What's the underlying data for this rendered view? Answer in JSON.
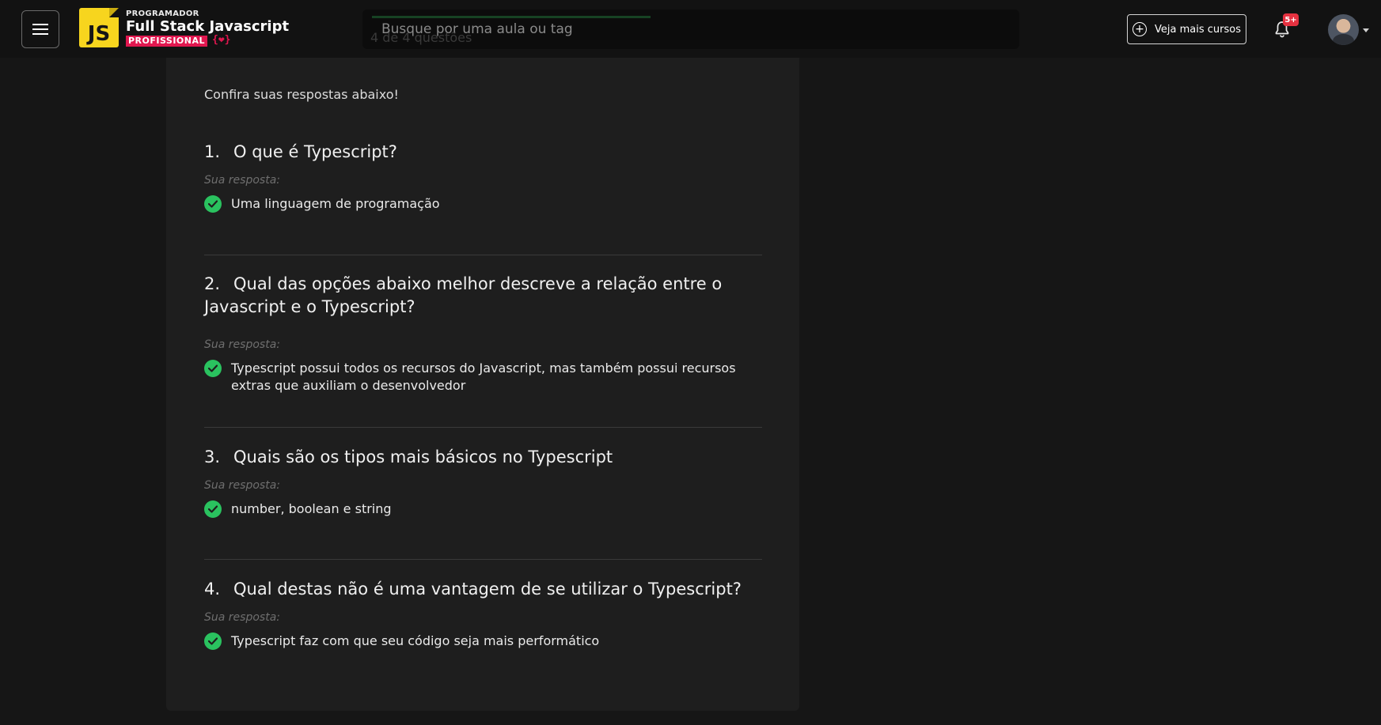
{
  "header": {
    "logo_badge": "JS",
    "logo_line1": "PROGRAMADOR",
    "logo_line2": "Full Stack Javascript",
    "logo_line3": "PROFISSIONAL",
    "logo_line3_suffix": "{❤}",
    "search_placeholder": "Busque por uma aula ou tag",
    "background_text": "4 de 4 questões",
    "more_courses_label": "Veja mais cursos",
    "notification_count": "5+",
    "icons": [
      "menu-icon",
      "plus-circle-icon",
      "bell-icon",
      "chevron-down-icon"
    ]
  },
  "colors": {
    "brand_yellow": "#f7d51e",
    "brand_pink": "#e0174f",
    "check_green": "#2ac25f",
    "badge_red": "#e53140"
  },
  "content": {
    "intro": "Confira suas respostas abaixo!",
    "answer_label": "Sua resposta:",
    "questions": [
      {
        "number": "1.",
        "title": "O que é Typescript?",
        "answer": "Uma linguagem de programação",
        "correct": true
      },
      {
        "number": "2.",
        "title": "Qual das opções abaixo melhor descreve a relação entre o Javascript e o Typescript?",
        "answer": "Typescript possui todos os recursos do Javascript, mas também possui recursos extras que auxiliam o desenvolvedor",
        "correct": true
      },
      {
        "number": "3.",
        "title": "Quais são os tipos mais básicos no Typescript",
        "answer": "number, boolean e string",
        "correct": true
      },
      {
        "number": "4.",
        "title": "Qual destas não é uma vantagem de se utilizar o Typescript?",
        "answer": "Typescript faz com que seu código seja mais performático",
        "correct": true
      }
    ]
  }
}
